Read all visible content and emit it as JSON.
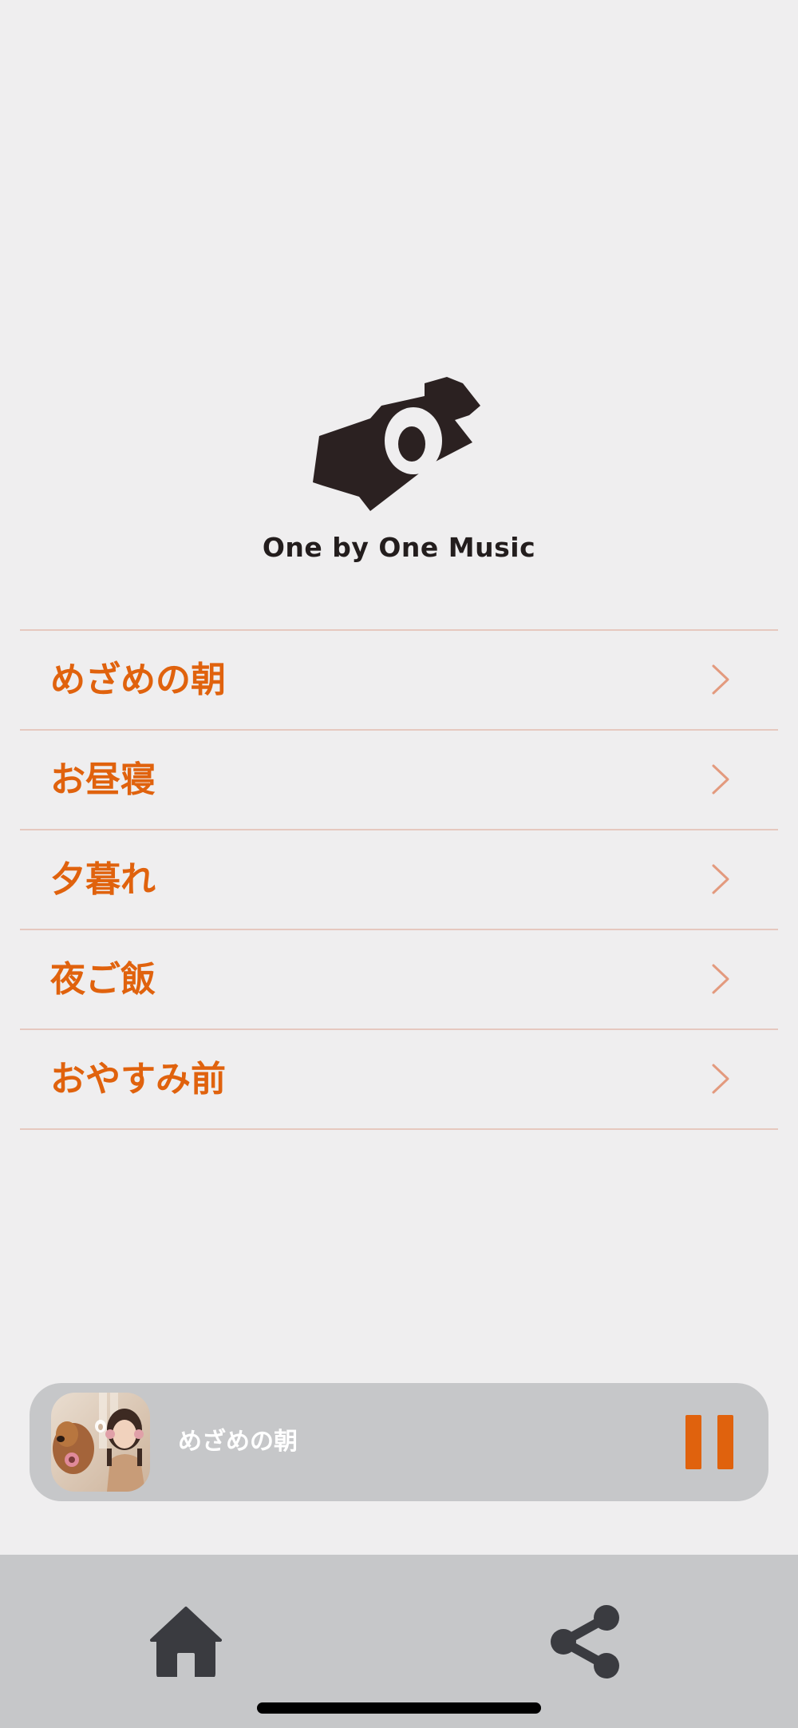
{
  "brand": {
    "name": "One by One Music"
  },
  "menu": {
    "items": [
      {
        "label": "めざめの朝"
      },
      {
        "label": "お昼寝"
      },
      {
        "label": "夕暮れ"
      },
      {
        "label": "夜ご飯"
      },
      {
        "label": "おやすみ前"
      }
    ]
  },
  "player": {
    "title": "めざめの朝",
    "state": "playing",
    "control_icon": "pause-icon"
  },
  "tabbar": {
    "items": [
      {
        "icon": "home-icon"
      },
      {
        "icon": "share-icon"
      }
    ]
  },
  "colors": {
    "background": "#efeeef",
    "accent": "#e0620d",
    "divider": "#e6c8bf",
    "chevron": "#e39a7e",
    "bar": "#c6c7c9",
    "icon_dark": "#3a3b40"
  }
}
